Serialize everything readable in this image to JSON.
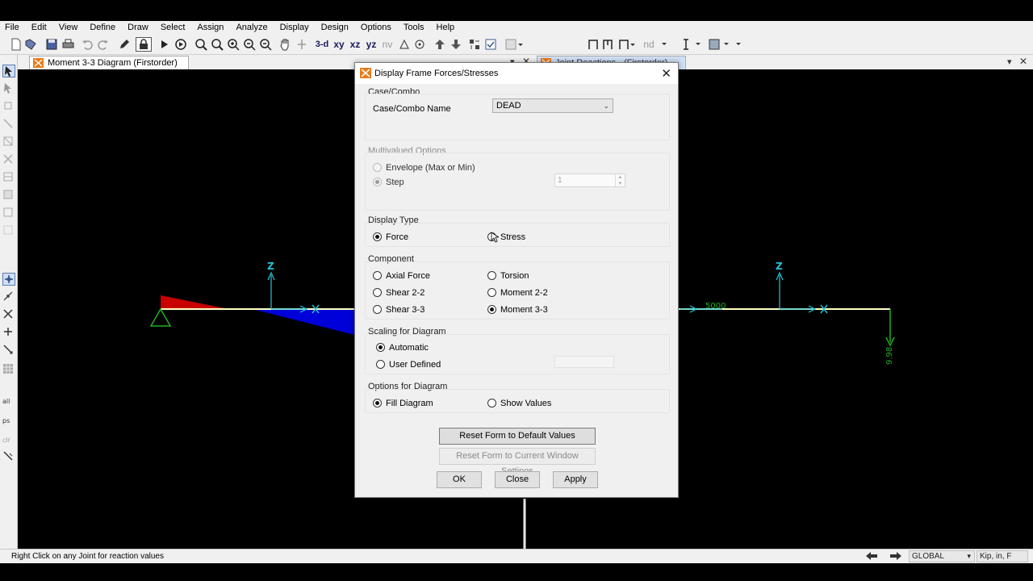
{
  "menu": [
    "File",
    "Edit",
    "View",
    "Define",
    "Draw",
    "Select",
    "Assign",
    "Analyze",
    "Display",
    "Design",
    "Options",
    "Tools",
    "Help"
  ],
  "toolbar": {
    "view_3d": "3-d",
    "view_xy": "xy",
    "view_xz": "xz",
    "view_yz": "yz",
    "view_nv": "nv",
    "nd": "nd"
  },
  "tabs": {
    "tab1": "Moment 3-3 Diagram (Firstorder)",
    "tab2": "Joint Reactions - (Firstorder)"
  },
  "viewport": {
    "axis_label_left": "Z",
    "axis_label_right": "Z",
    "value_5000": "5000",
    "value_998": "9.98"
  },
  "dialog": {
    "title": "Display Frame Forces/Stresses",
    "case_group": "Case/Combo",
    "case_name_label": "Case/Combo Name",
    "case_value": "DEAD",
    "multi_group": "Multivalued Options",
    "envelope_label": "Envelope (Max or Min)",
    "step_label": "Step",
    "step_value": "1",
    "display_type_group": "Display Type",
    "force_label": "Force",
    "stress_label": "Stress",
    "component_group": "Component",
    "axial_label": "Axial Force",
    "torsion_label": "Torsion",
    "shear22_label": "Shear 2-2",
    "moment22_label": "Moment 2-2",
    "shear33_label": "Shear 3-3",
    "moment33_label": "Moment 3-3",
    "scaling_group": "Scaling for Diagram",
    "automatic_label": "Automatic",
    "user_defined_label": "User Defined",
    "options_group": "Options for Diagram",
    "fill_label": "Fill Diagram",
    "show_values_label": "Show Values",
    "reset_default": "Reset Form to Default Values",
    "reset_current": "Reset Form to Current Window Settings",
    "ok": "OK",
    "close": "Close",
    "apply": "Apply"
  },
  "status": {
    "text": "Right Click on any Joint for reaction values",
    "coord": "GLOBAL",
    "units": "Kip, in, F"
  },
  "colors": {
    "dialog_bg": "#f0f0f0",
    "viewport_bg": "#000000",
    "beam": "#ffffc0",
    "axis": "#24c4d8",
    "moment_pos": "#c80000",
    "moment_neg": "#0000d8",
    "support": "#1fb020"
  }
}
